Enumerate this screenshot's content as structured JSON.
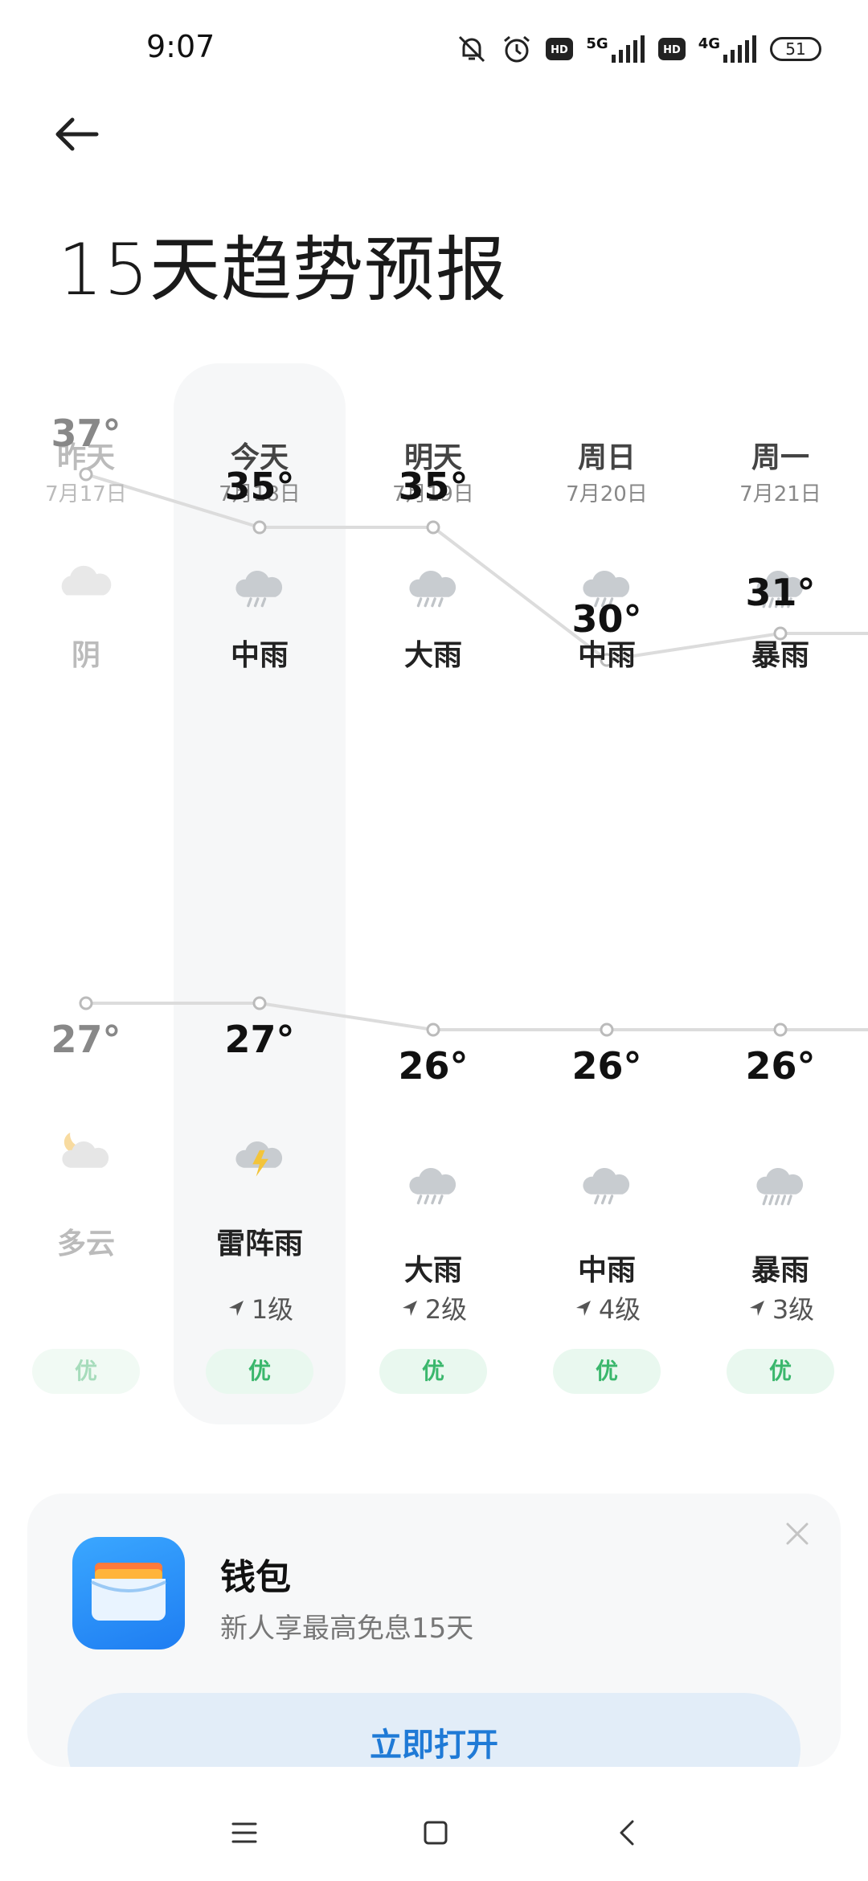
{
  "status": {
    "time": "9:07",
    "signal1": "5G",
    "signal2": "4G",
    "battery": "51"
  },
  "page": {
    "title": "15天趋势预报"
  },
  "days": [
    {
      "day": "昨天",
      "date": "7月17日",
      "day_cond": "阴",
      "day_icon": "cloudy-icon",
      "high": "37°",
      "high_value": 37,
      "low": "27°",
      "low_value": 27,
      "night_cond": "多云",
      "night_icon": "partly-cloudy-night-icon",
      "wind": "",
      "aqi": "优",
      "past": true
    },
    {
      "day": "今天",
      "date": "7月18日",
      "day_cond": "中雨",
      "day_icon": "moderate-rain-icon",
      "high": "35°",
      "high_value": 35,
      "low": "27°",
      "low_value": 27,
      "night_cond": "雷阵雨",
      "night_icon": "thunderstorm-icon",
      "wind": "1级",
      "aqi": "优",
      "past": false
    },
    {
      "day": "明天",
      "date": "7月19日",
      "day_cond": "大雨",
      "day_icon": "heavy-rain-icon",
      "high": "35°",
      "high_value": 35,
      "low": "26°",
      "low_value": 26,
      "night_cond": "大雨",
      "night_icon": "heavy-rain-icon",
      "wind": "2级",
      "aqi": "优",
      "past": false
    },
    {
      "day": "周日",
      "date": "7月20日",
      "day_cond": "中雨",
      "day_icon": "moderate-rain-icon",
      "high": "30°",
      "high_value": 30,
      "low": "26°",
      "low_value": 26,
      "night_cond": "中雨",
      "night_icon": "moderate-rain-icon",
      "wind": "4级",
      "aqi": "优",
      "past": false
    },
    {
      "day": "周一",
      "date": "7月21日",
      "day_cond": "暴雨",
      "day_icon": "rainstorm-icon",
      "high": "31°",
      "high_value": 31,
      "low": "26°",
      "low_value": 26,
      "night_cond": "暴雨",
      "night_icon": "rainstorm-icon",
      "wind": "3级",
      "aqi": "优",
      "past": false
    }
  ],
  "ad": {
    "title": "钱包",
    "subtitle": "新人享最高免息15天",
    "button": "立即打开"
  },
  "colors": {
    "aqi_good": "#3ab76c",
    "accent": "#1f7ad6",
    "line": "#dcdcdc"
  }
}
